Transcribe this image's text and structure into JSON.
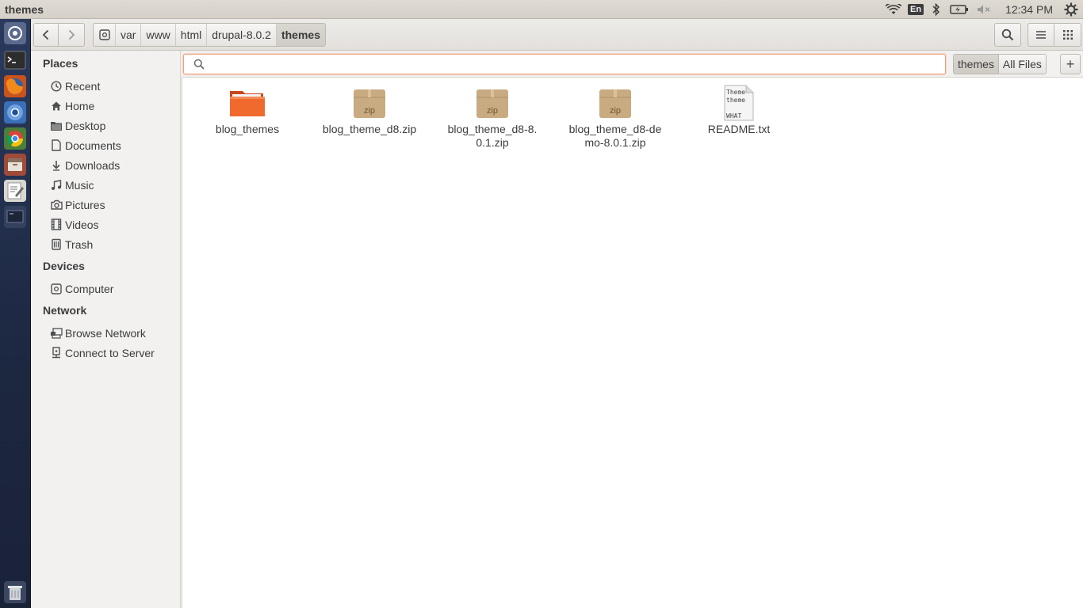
{
  "window": {
    "title": "themes"
  },
  "panel": {
    "language": "En",
    "clock": "12:34 PM"
  },
  "launcher": {
    "items": [
      "dash-icon",
      "terminal-icon",
      "firefox-icon",
      "chromium-icon",
      "chrome-icon",
      "files-icon",
      "text-editor-icon",
      "workspace-icon",
      "trash-icon"
    ]
  },
  "toolbar": {
    "breadcrumbs": [
      "var",
      "www",
      "html",
      "drupal-8.0.2",
      "themes"
    ]
  },
  "sidebar": {
    "places_header": "Places",
    "places": [
      {
        "label": "Recent",
        "icon": "clock-icon"
      },
      {
        "label": "Home",
        "icon": "home-icon"
      },
      {
        "label": "Desktop",
        "icon": "folder-icon"
      },
      {
        "label": "Documents",
        "icon": "document-icon"
      },
      {
        "label": "Downloads",
        "icon": "download-icon"
      },
      {
        "label": "Music",
        "icon": "music-icon"
      },
      {
        "label": "Pictures",
        "icon": "camera-icon"
      },
      {
        "label": "Videos",
        "icon": "film-icon"
      },
      {
        "label": "Trash",
        "icon": "trash-icon"
      }
    ],
    "devices_header": "Devices",
    "devices": [
      {
        "label": "Computer",
        "icon": "drive-icon"
      }
    ],
    "network_header": "Network",
    "network": [
      {
        "label": "Browse Network",
        "icon": "network-icon"
      },
      {
        "label": "Connect to Server",
        "icon": "server-icon"
      }
    ]
  },
  "search": {
    "value": "",
    "placeholder": "",
    "scopes": [
      "themes",
      "All Files"
    ],
    "active_scope": "themes",
    "add_label": "+"
  },
  "files": [
    {
      "name": "blog_themes",
      "type": "folder"
    },
    {
      "name": "blog_theme_d8.zip",
      "type": "zip",
      "badge": "zip"
    },
    {
      "name": "blog_theme_d8-8.0.1.zip",
      "type": "zip",
      "badge": "zip"
    },
    {
      "name": "blog_theme_d8-demo-8.0.1.zip",
      "type": "zip",
      "badge": "zip"
    },
    {
      "name": "README.txt",
      "type": "text",
      "preview": [
        "Theme",
        "theme",
        "WHAT"
      ]
    }
  ],
  "colors": {
    "accent": "#e95420",
    "launcher_bg": "#1c2740",
    "panel_bg": "#dfdbd2"
  }
}
